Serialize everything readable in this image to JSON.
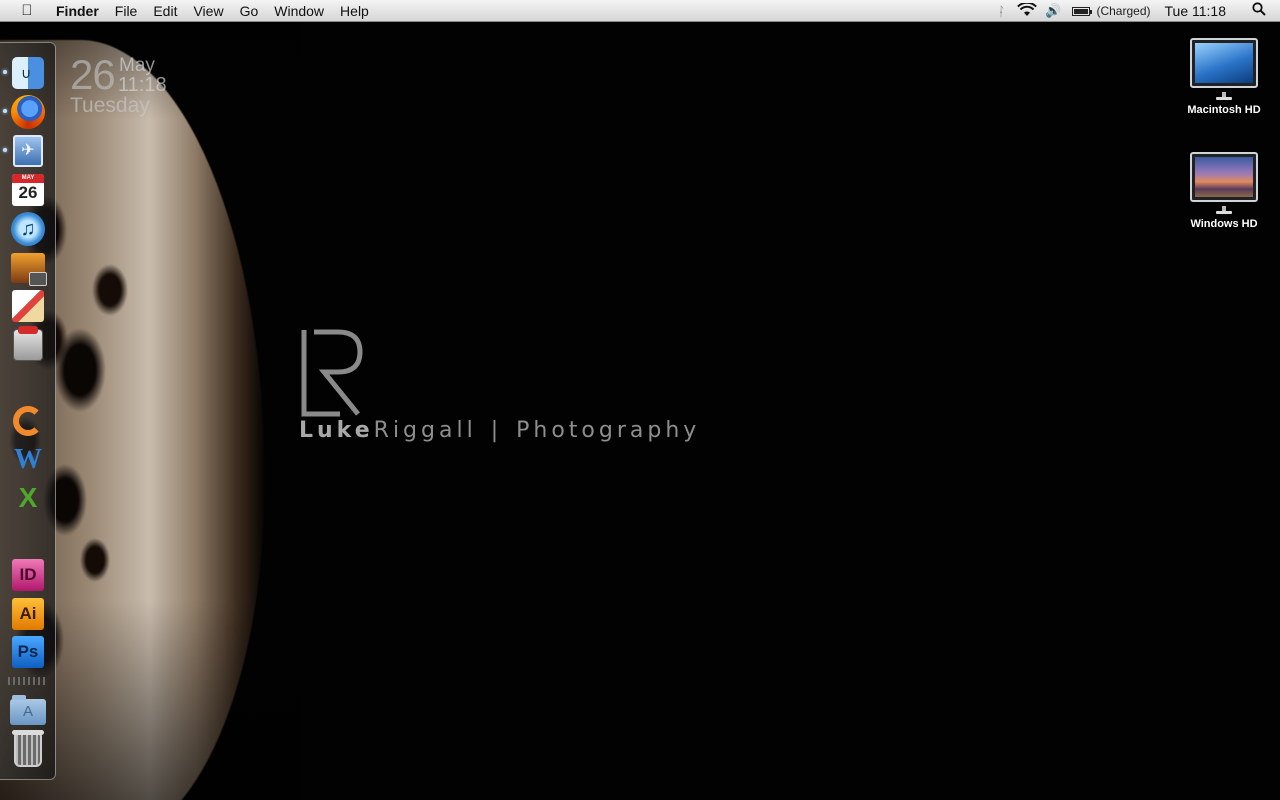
{
  "menubar": {
    "apple_icon": "apple-icon",
    "app_name": "Finder",
    "menus": [
      "File",
      "Edit",
      "View",
      "Go",
      "Window",
      "Help"
    ],
    "status": {
      "bluetooth_icon": "bluetooth-icon",
      "wifi_icon": "wifi-icon",
      "volume_icon": "volume-icon",
      "battery_icon": "battery-icon",
      "battery_level": 1.0,
      "battery_text": "(Charged)",
      "clock": "Tue 11:18",
      "spotlight_icon": "spotlight-search-icon"
    }
  },
  "date_widget": {
    "day": "26",
    "month": "May",
    "time": "11:18",
    "weekday": "Tuesday"
  },
  "wallpaper": {
    "brand_first": "Luke",
    "brand_last": "Riggall",
    "brand_separator": "|",
    "brand_tagline": "Photography"
  },
  "desktop_icons": [
    {
      "label": "Macintosh HD",
      "icon": "macintosh-hd-icon"
    },
    {
      "label": "Windows HD",
      "icon": "windows-hd-icon"
    }
  ],
  "dock": {
    "items": [
      {
        "name": "finder",
        "running": true
      },
      {
        "name": "firefox",
        "running": true
      },
      {
        "name": "mail",
        "running": true
      },
      {
        "name": "ical",
        "running": false,
        "date_label": "26"
      },
      {
        "name": "itunes",
        "running": false
      },
      {
        "name": "iphoto",
        "running": false
      },
      {
        "name": "textedit",
        "running": false
      },
      {
        "name": "installer",
        "running": false
      },
      {
        "name": "powerpoint",
        "running": false
      },
      {
        "name": "word",
        "running": false
      },
      {
        "name": "excel",
        "running": false
      },
      {
        "name": "indesign",
        "running": false,
        "label": "ID"
      },
      {
        "name": "illustrator",
        "running": false,
        "label": "Ai"
      },
      {
        "name": "photoshop",
        "running": false,
        "label": "Ps"
      },
      {
        "name": "applications-folder",
        "running": false
      },
      {
        "name": "trash",
        "running": false
      }
    ]
  },
  "colors": {
    "menubar_top": "#f4f4f4",
    "menubar_bottom": "#d6d6d6",
    "desktop_bg": "#000000",
    "watermark_text": "#9a9a9a"
  }
}
